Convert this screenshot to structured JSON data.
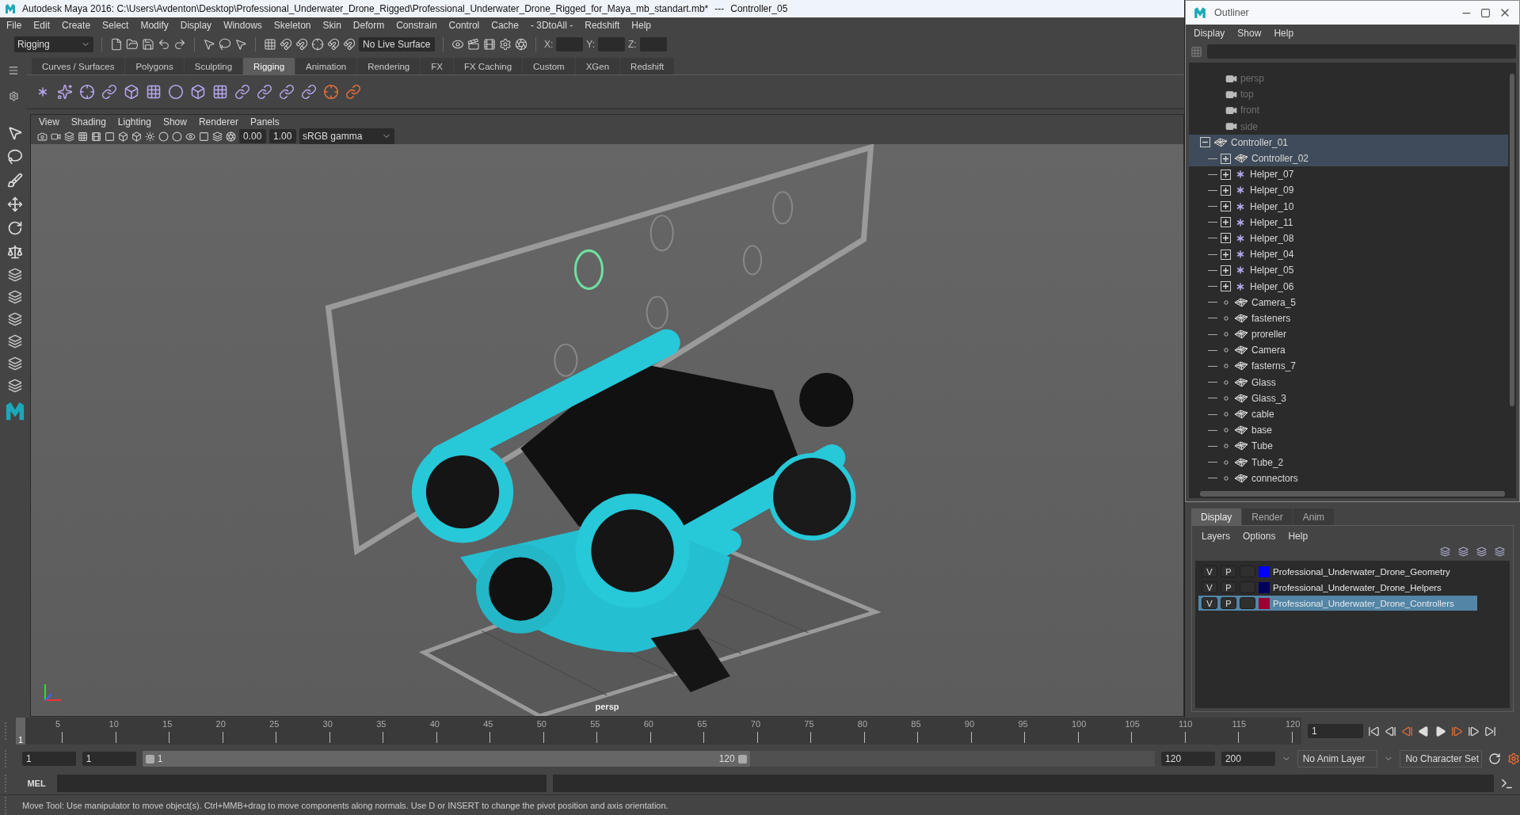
{
  "window": {
    "title": "Autodesk Maya 2016: C:\\Users\\Avdenton\\Desktop\\Professional_Underwater_Drone_Rigged\\Professional_Underwater_Drone_Rigged_for_Maya_mb_standart.mb*",
    "separator": "---",
    "object": "Controller_05"
  },
  "menu": [
    "File",
    "Edit",
    "Create",
    "Select",
    "Modify",
    "Display",
    "Windows",
    "Skeleton",
    "Skin",
    "Deform",
    "Constrain",
    "Control",
    "Cache",
    "- 3DtoAll -",
    "Redshift",
    "Help"
  ],
  "toolbar": {
    "mode": "Rigging",
    "live_surface": "No Live Surface",
    "coords": [
      "X:",
      "Y:",
      "Z:"
    ]
  },
  "shelf_tabs": [
    {
      "label": "Curves / Surfaces",
      "selected": false
    },
    {
      "label": "Polygons",
      "selected": false
    },
    {
      "label": "Sculpting",
      "selected": false
    },
    {
      "label": "Rigging",
      "selected": true
    },
    {
      "label": "Animation",
      "selected": false
    },
    {
      "label": "Rendering",
      "selected": false
    },
    {
      "label": "FX",
      "selected": false
    },
    {
      "label": "FX Caching",
      "selected": false
    },
    {
      "label": "Custom",
      "selected": false
    },
    {
      "label": "XGen",
      "selected": false
    },
    {
      "label": "Redshift",
      "selected": false
    }
  ],
  "viewport": {
    "menu": [
      "View",
      "Shading",
      "Lighting",
      "Show",
      "Renderer",
      "Panels"
    ],
    "exposure": "0.00",
    "gamma": "1.00",
    "color_space": "sRGB gamma",
    "camera": "persp"
  },
  "outliner": {
    "title": "Outliner",
    "menu": [
      "Display",
      "Show",
      "Help"
    ],
    "items": [
      {
        "name": "persp",
        "kind": "camera",
        "selected": false
      },
      {
        "name": "top",
        "kind": "camera",
        "selected": false
      },
      {
        "name": "front",
        "kind": "camera",
        "selected": false
      },
      {
        "name": "side",
        "kind": "camera",
        "selected": false
      },
      {
        "name": "Controller_01",
        "kind": "mesh",
        "selected": true,
        "expanded": true,
        "children": [
          {
            "name": "Controller_02",
            "kind": "mesh",
            "selected": true,
            "expanded": false
          },
          {
            "name": "Helper_07",
            "kind": "helper",
            "selected": false,
            "expanded": false
          },
          {
            "name": "Helper_09",
            "kind": "helper",
            "selected": false,
            "expanded": false
          },
          {
            "name": "Helper_10",
            "kind": "helper",
            "selected": false,
            "expanded": false
          },
          {
            "name": "Helper_11",
            "kind": "helper",
            "selected": false,
            "expanded": false
          },
          {
            "name": "Helper_08",
            "kind": "helper",
            "selected": false,
            "expanded": false
          },
          {
            "name": "Helper_04",
            "kind": "helper",
            "selected": false,
            "expanded": false
          },
          {
            "name": "Helper_05",
            "kind": "helper",
            "selected": false,
            "expanded": false
          },
          {
            "name": "Helper_06",
            "kind": "helper",
            "selected": false,
            "expanded": false
          },
          {
            "name": "Camera_5",
            "kind": "mesh",
            "selected": false
          },
          {
            "name": "fasteners",
            "kind": "mesh",
            "selected": false
          },
          {
            "name": "proreller",
            "kind": "mesh",
            "selected": false
          },
          {
            "name": "Camera",
            "kind": "mesh",
            "selected": false
          },
          {
            "name": "fasterns_7",
            "kind": "mesh",
            "selected": false
          },
          {
            "name": "Glass",
            "kind": "mesh",
            "selected": false
          },
          {
            "name": "Glass_3",
            "kind": "mesh",
            "selected": false
          },
          {
            "name": "cable",
            "kind": "mesh",
            "selected": false
          },
          {
            "name": "base",
            "kind": "mesh",
            "selected": false
          },
          {
            "name": "Tube",
            "kind": "mesh",
            "selected": false
          },
          {
            "name": "Tube_2",
            "kind": "mesh",
            "selected": false
          },
          {
            "name": "connectors",
            "kind": "mesh",
            "selected": false
          }
        ]
      }
    ]
  },
  "layers": {
    "tabs": [
      {
        "label": "Display",
        "selected": true
      },
      {
        "label": "Render",
        "selected": false
      },
      {
        "label": "Anim",
        "selected": false
      }
    ],
    "menu": [
      "Layers",
      "Options",
      "Help"
    ],
    "rows": [
      {
        "visible": "V",
        "playback": "P",
        "color": "#0000ff",
        "name": "Professional_Underwater_Drone_Geometry",
        "selected": false
      },
      {
        "visible": "V",
        "playback": "P",
        "color": "#000060",
        "name": "Professional_Underwater_Drone_Helpers",
        "selected": false
      },
      {
        "visible": "V",
        "playback": "P",
        "color": "#990033",
        "name": "Professional_Underwater_Drone_Controllers",
        "selected": true
      }
    ]
  },
  "timeline": {
    "ticks": [
      "5",
      "10",
      "15",
      "20",
      "25",
      "30",
      "35",
      "40",
      "45",
      "50",
      "55",
      "60",
      "65",
      "70",
      "75",
      "80",
      "85",
      "90",
      "95",
      "100",
      "105",
      "110",
      "115",
      "120"
    ],
    "current": "1",
    "frame_field": "1"
  },
  "range": {
    "start": "1",
    "playback_start": "1",
    "slider_start": "1",
    "slider_end": "120",
    "level": 0.6,
    "playback_end": "120",
    "end": "200",
    "anim_layer": "No Anim Layer",
    "character_set": "No Character Set"
  },
  "command_line": {
    "label": "MEL"
  },
  "help_line": "Move Tool: Use manipulator to move object(s). Ctrl+MMB+drag to move components along normals. Use D or INSERT to change the pivot position and axis orientation."
}
